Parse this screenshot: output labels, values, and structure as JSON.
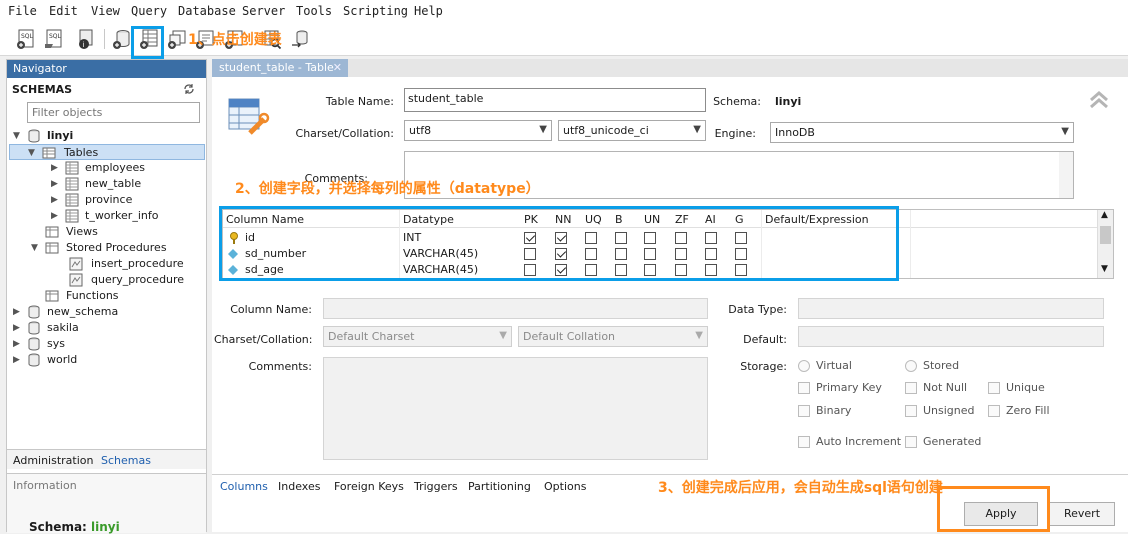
{
  "menubar": [
    "File",
    "Edit",
    "View",
    "Query",
    "Database",
    "Server",
    "Tools",
    "Scripting",
    "Help"
  ],
  "annotations": {
    "step1": "1、点击创建表",
    "step2": "2、创建字段，并选择每列的属性（datatype）",
    "step3": "3、创建完成后应用，会自动生成sql语句创建"
  },
  "navigator": {
    "title": "Navigator",
    "schemas_label": "SCHEMAS",
    "filter_placeholder": "Filter objects",
    "tree": {
      "linyi": "linyi",
      "tables": "Tables",
      "table_items": [
        "employees",
        "new_table",
        "province",
        "t_worker_info"
      ],
      "views": "Views",
      "stored_procedures": "Stored Procedures",
      "procedures": [
        "insert_procedure",
        "query_procedure"
      ],
      "functions": "Functions",
      "other_schemas": [
        "new_schema",
        "sakila",
        "sys",
        "world"
      ]
    },
    "tabs": [
      "Administration",
      "Schemas"
    ],
    "information_label": "Information",
    "schema_label": "Schema:",
    "schema_value": "linyi"
  },
  "editor": {
    "tab_title": "student_table - Table",
    "table_name_label": "Table Name:",
    "table_name": "student_table",
    "schema_label": "Schema:",
    "schema_value": "linyi",
    "charset_label": "Charset/Collation:",
    "charset": "utf8",
    "collation": "utf8_unicode_ci",
    "engine_label": "Engine:",
    "engine": "InnoDB",
    "comments_label": "Comments:"
  },
  "grid": {
    "headers": [
      "Column Name",
      "Datatype",
      "PK",
      "NN",
      "UQ",
      "B",
      "UN",
      "ZF",
      "AI",
      "G",
      "Default/Expression"
    ],
    "rows": [
      {
        "name": "id",
        "type": "INT",
        "checks": [
          true,
          true,
          false,
          false,
          false,
          false,
          false,
          false
        ]
      },
      {
        "name": "sd_number",
        "type": "VARCHAR(45)",
        "checks": [
          false,
          true,
          false,
          false,
          false,
          false,
          false,
          false
        ]
      },
      {
        "name": "sd_age",
        "type": "VARCHAR(45)",
        "checks": [
          false,
          true,
          false,
          false,
          false,
          false,
          false,
          false
        ]
      }
    ]
  },
  "details": {
    "column_name_label": "Column Name:",
    "data_type_label": "Data Type:",
    "charset_label": "Charset/Collation:",
    "default_charset": "Default Charset",
    "default_collation": "Default Collation",
    "default_label": "Default:",
    "comments_label": "Comments:",
    "storage_label": "Storage:",
    "storage_options": [
      "Virtual",
      "Stored"
    ],
    "flags": [
      "Primary Key",
      "Not Null",
      "Unique",
      "Binary",
      "Unsigned",
      "Zero Fill",
      "Auto Increment",
      "Generated"
    ]
  },
  "bottom_tabs": [
    "Columns",
    "Indexes",
    "Foreign Keys",
    "Triggers",
    "Partitioning",
    "Options"
  ],
  "buttons": {
    "apply": "Apply",
    "revert": "Revert"
  },
  "colors": {
    "accent_blue": "#0b9ee8",
    "annotation_orange": "#ff8a1c",
    "navigator_header": "#3a6ea5",
    "schema_green": "#3a9b2a"
  }
}
